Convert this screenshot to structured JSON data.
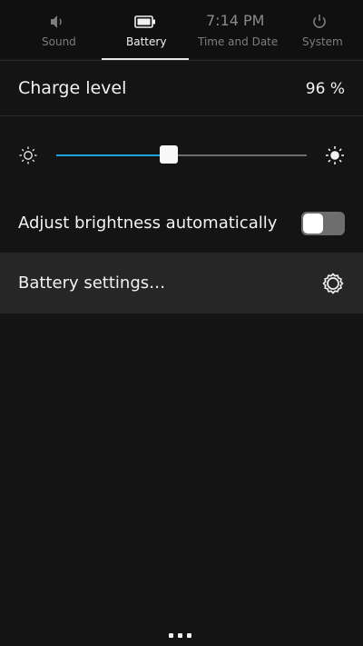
{
  "tabs": [
    {
      "label": "Sound",
      "icon": "speaker-icon"
    },
    {
      "label": "Battery",
      "icon": "battery-icon"
    },
    {
      "time": "7:14 PM",
      "label": "Time and Date"
    },
    {
      "label": "System",
      "icon": "power-icon"
    }
  ],
  "charge": {
    "label": "Charge level",
    "value": "96 %"
  },
  "brightness": {
    "level": 0.45,
    "min_icon": "sun-dim-icon",
    "max_icon": "sun-bright-icon"
  },
  "auto_brightness": {
    "label": "Adjust brightness automatically",
    "enabled": false
  },
  "battery_settings": {
    "label": "Battery settings…",
    "icon": "gear-icon"
  },
  "colors": {
    "accent": "#19a3e3",
    "background": "#141414",
    "highlight_row": "#262626"
  }
}
